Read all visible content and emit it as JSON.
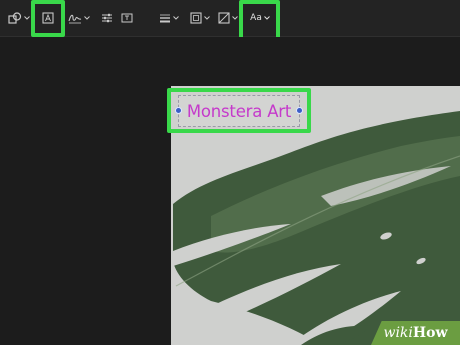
{
  "toolbar": {
    "items": [
      {
        "name": "shapes-tool",
        "icon": "shapes-icon",
        "has_menu": true
      },
      {
        "name": "text-tool",
        "icon": "text-box-icon",
        "has_menu": false,
        "highlighted": true
      },
      {
        "name": "sign-tool",
        "icon": "signature-icon",
        "has_menu": true
      },
      {
        "name": "adjust-tool",
        "icon": "sliders-icon",
        "has_menu": false
      },
      {
        "name": "info-tool",
        "icon": "info-panel-icon",
        "has_menu": false
      },
      {
        "name": "line-style-tool",
        "icon": "line-weight-icon",
        "has_menu": true
      },
      {
        "name": "border-color-tool",
        "icon": "border-color-icon",
        "has_menu": true
      },
      {
        "name": "fill-color-tool",
        "icon": "fill-color-icon",
        "has_menu": true
      },
      {
        "name": "text-style-tool",
        "icon": "text-style-icon",
        "has_menu": true,
        "highlighted": true
      }
    ],
    "text_style_label": "Aa"
  },
  "canvas": {
    "title_text": "Monstera Art",
    "title_color": "#c53acb"
  },
  "watermark": {
    "wiki": "wiki",
    "how": "How"
  },
  "colors": {
    "highlight": "#39d84a",
    "background": "#1c1c1c",
    "toolbar": "#232323",
    "image_bg": "#cfd0ce",
    "leaf_dark": "#3f5a3c",
    "watermark_bg": "#6b9d41"
  }
}
